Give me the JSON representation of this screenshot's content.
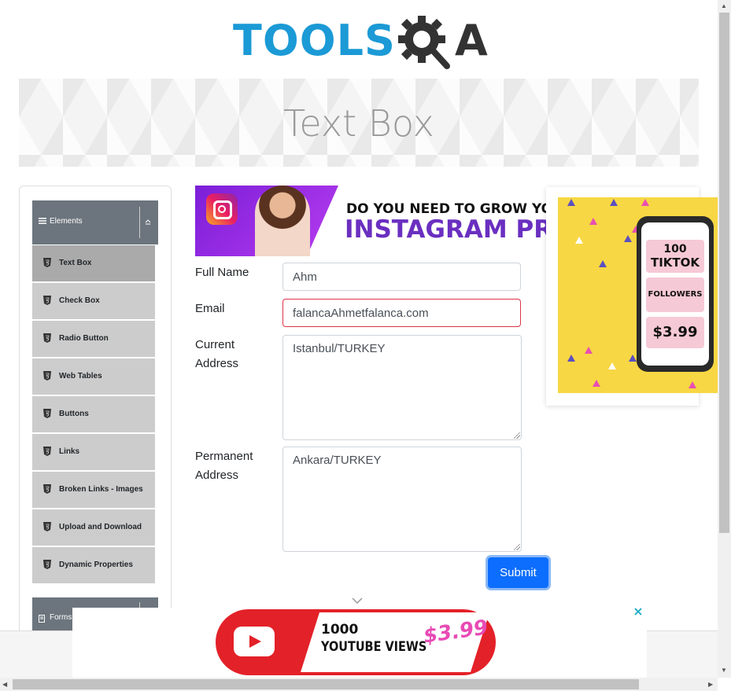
{
  "logo": {
    "part1": "TOOLS",
    "part2": "A"
  },
  "banner": {
    "title": "Text Box"
  },
  "sidebar": {
    "group_label": "Elements",
    "items": [
      {
        "label": "Text Box"
      },
      {
        "label": "Check Box"
      },
      {
        "label": "Radio Button"
      },
      {
        "label": "Web Tables"
      },
      {
        "label": "Buttons"
      },
      {
        "label": "Links"
      },
      {
        "label": "Broken Links - Images"
      },
      {
        "label": "Upload and Download"
      },
      {
        "label": "Dynamic Properties"
      }
    ],
    "next_group_label": "Forms"
  },
  "ad_instagram": {
    "line1": "DO YOU NEED TO GROW YOU",
    "line2": "INSTAGRAM PRO"
  },
  "form": {
    "full_name": {
      "label": "Full Name",
      "value": "Ahm"
    },
    "email": {
      "label": "Email",
      "value": "falancaAhmetfalanca.com"
    },
    "current_address": {
      "label_line1": "Current",
      "label_line2": "Address",
      "value": "Istanbul/TURKEY"
    },
    "permanent_address": {
      "label_line1": "Permanent",
      "label_line2": "Address",
      "value": "Ankara/TURKEY"
    },
    "submit_label": "Submit"
  },
  "ad_tiktok": {
    "count": "100",
    "platform": "TIKTOK",
    "unit": "FOLLOWERS",
    "price": "$3.99"
  },
  "ad_youtube": {
    "line1": "1000",
    "line2": "YOUTUBE VIEWS",
    "price": "$3.99"
  },
  "colors": {
    "primary": "#0d6efd",
    "error": "#dc3545",
    "sidebar_header": "#6c757d",
    "logo_blue": "#1b9ad6",
    "logo_dark": "#333333"
  }
}
